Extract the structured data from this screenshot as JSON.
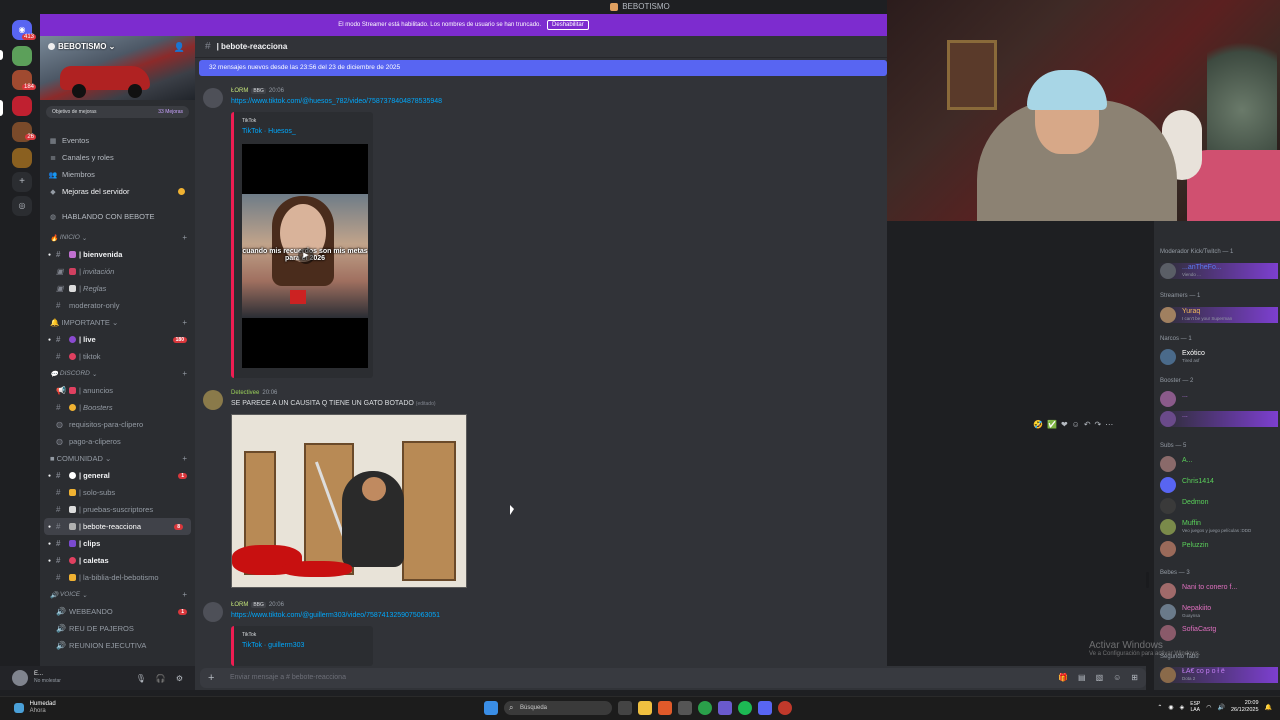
{
  "window": {
    "title": "BEBOTISMO"
  },
  "streamer_bar": {
    "text": "El modo Streamer está habilitado. Los nombres de usuario se han truncado.",
    "button": "Deshabilitar"
  },
  "rail": {
    "home_badge": "413",
    "badges": [
      "184",
      "26"
    ]
  },
  "server": {
    "name": "BEBOTISMO",
    "goal_label": "Objetivo de mejoras",
    "goal_value": "33 Mejoras"
  },
  "nav": [
    {
      "label": "Eventos",
      "icon": "calendar-icon"
    },
    {
      "label": "Canales y roles",
      "icon": "list-icon"
    },
    {
      "label": "Miembros",
      "icon": "members-icon"
    },
    {
      "label": "Mejoras del servidor",
      "icon": "boost-icon"
    }
  ],
  "sections": {
    "hablando": "HABLANDO CON BEBOTE",
    "inicio": "INICIO",
    "importante": "IMPORTANTE",
    "discord": "DISCORD",
    "comunidad": "COMUNIDAD",
    "voice": "VOICE"
  },
  "channels": {
    "inicio": [
      "| bienvenida",
      "| invitación",
      "| Reglas",
      "moderator-only"
    ],
    "importante": [
      "| live",
      "| tiktok"
    ],
    "discord": [
      "| anuncios",
      "| Boosters",
      "requisitos-para-clipero",
      "pago-a-cliperos"
    ],
    "comunidad": [
      "| general",
      "| solo-subs",
      "| pruebas-suscriptores",
      "| bebote-reacciona",
      "| clips",
      "| caletas",
      "| la-biblia-del-bebotismo"
    ],
    "voice": [
      "WEBEANDO",
      "REU DE PAJEROS",
      "REUNION EJECUTIVA"
    ]
  },
  "counts": {
    "live": "180",
    "general": "1",
    "bebote": "8",
    "webeando": "1"
  },
  "user": {
    "name": "E...",
    "status": "No molestar"
  },
  "chat": {
    "channel": "| bebote-reacciona",
    "new_messages": "32 mensajes nuevos desde las 23:56 del 23 de diciembre de 2025",
    "composer_placeholder": "Enviar mensaje a #  bebote-reacciona"
  },
  "messages": [
    {
      "author": "ŁORM",
      "tag": "BBG",
      "time": "20:06",
      "link": "https://www.tiktok.com/@huesos_782/video/7587378404878535948",
      "provider": "TikTok",
      "title": "TikTok · Huesos_",
      "caption": "cuando mis recuerdos son mis metas para el 2026"
    },
    {
      "author": "Detectivee",
      "time": "20:06",
      "text": "SE PARECE A UN CAUSITA Q TIENE UN GATO BOTADO",
      "edited": "(editado)"
    },
    {
      "author": "ŁORM",
      "tag": "BBG",
      "time": "20:06",
      "link": "https://www.tiktok.com/@guillerm303/video/7587413259075063051",
      "provider": "TikTok",
      "title": "TikTok · guillerm303"
    }
  ],
  "members": {
    "groups": [
      {
        "label": "Moderador Kick/Twitch — 1"
      },
      {
        "label": "Streamers — 1"
      },
      {
        "label": "Narcos — 1"
      },
      {
        "label": "Booster — 2"
      },
      {
        "label": "Subs — 5"
      },
      {
        "label": "Bebes — 3"
      },
      {
        "label": "Segundo Tabú"
      }
    ],
    "items": [
      {
        "name": "...anTheFo...",
        "sub": "Viendo ...",
        "color": "#5b7bf0"
      },
      {
        "name": "Yuraq",
        "sub": "I can't be your Superman",
        "color": "#f0b85a"
      },
      {
        "name": "Exótico",
        "sub": "Tired asf",
        "color": "#ffffff"
      },
      {
        "name": "...",
        "sub": "",
        "color": "#c07cf0"
      },
      {
        "name": "...",
        "sub": "",
        "color": "#c07cf0"
      },
      {
        "name": "A...",
        "sub": "",
        "color": "#5ad05a"
      },
      {
        "name": "Chris1414",
        "sub": "",
        "color": "#5ad05a"
      },
      {
        "name": "Dedmon",
        "sub": "",
        "color": "#5ad05a"
      },
      {
        "name": "Muffin",
        "sub": "Veo juegos y juego películas :DDD",
        "color": "#5ad05a"
      },
      {
        "name": "Peluzzin",
        "sub": "",
        "color": "#5ad05a"
      },
      {
        "name": "Nani to conero f...",
        "sub": "",
        "color": "#e070c0"
      },
      {
        "name": "Nepakiito",
        "sub": "Guaynsa",
        "color": "#e070c0"
      },
      {
        "name": "SofiaCastg",
        "sub": "",
        "color": "#e070c0"
      },
      {
        "name": "ŁA€ co p o ł ë",
        "sub": "Dota 2",
        "color": "#c07cf0"
      },
      {
        "name": "...Mr.Veuz...",
        "sub": "",
        "color": "#dbdee1"
      }
    ]
  },
  "activate_windows": {
    "title": "Activar Windows",
    "sub": "Ve a Configuración para activar Windows."
  },
  "taskbar": {
    "weather_title": "Humedad",
    "weather_sub": "Ahora",
    "search": "Búsqueda",
    "lang_top": "ESP",
    "lang_bottom": "LAA",
    "time": "20:09",
    "date": "26/12/2025"
  },
  "colors": {
    "accent": "#5865f2",
    "streamer": "#7d2ccf",
    "link": "#00a8fc"
  }
}
